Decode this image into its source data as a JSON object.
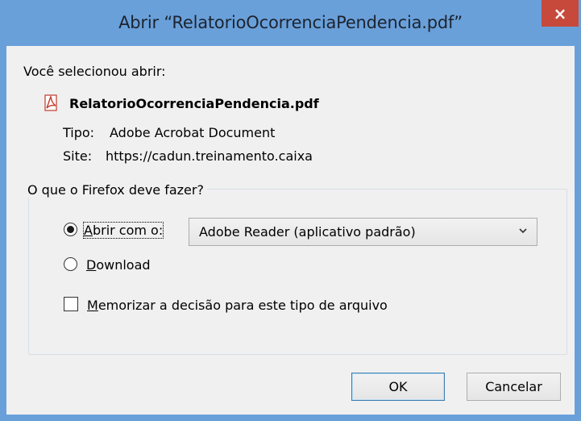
{
  "window": {
    "title": "Abrir “RelatorioOcorrenciaPendencia.pdf”",
    "close_label": "×"
  },
  "header": {
    "intro": "Você selecionou abrir:"
  },
  "file": {
    "name": "RelatorioOcorrenciaPendencia.pdf",
    "icon": "pdf-file-icon",
    "type_label": "Tipo:",
    "type_value": "Adobe Acrobat Document",
    "site_label": "Site:",
    "site_value": "https://cadun.treinamento.caixa"
  },
  "action_group": {
    "legend": "O que o Firefox deve fazer?",
    "open_with": {
      "label_access_key": "A",
      "label_rest": "brir com o:",
      "selected": true
    },
    "open_with_app": {
      "value": "Adobe Reader  (aplicativo padrão)"
    },
    "download": {
      "label_access_key": "D",
      "label_rest": "ownload",
      "selected": false
    },
    "remember": {
      "label_access_key": "M",
      "label_rest": "emorizar a decisão para este tipo de arquivo",
      "checked": false
    }
  },
  "buttons": {
    "ok": "OK",
    "cancel": "Cancelar"
  },
  "colors": {
    "titlebar": "#6aa0da",
    "close": "#c7493b",
    "client": "#f0f0f0"
  }
}
